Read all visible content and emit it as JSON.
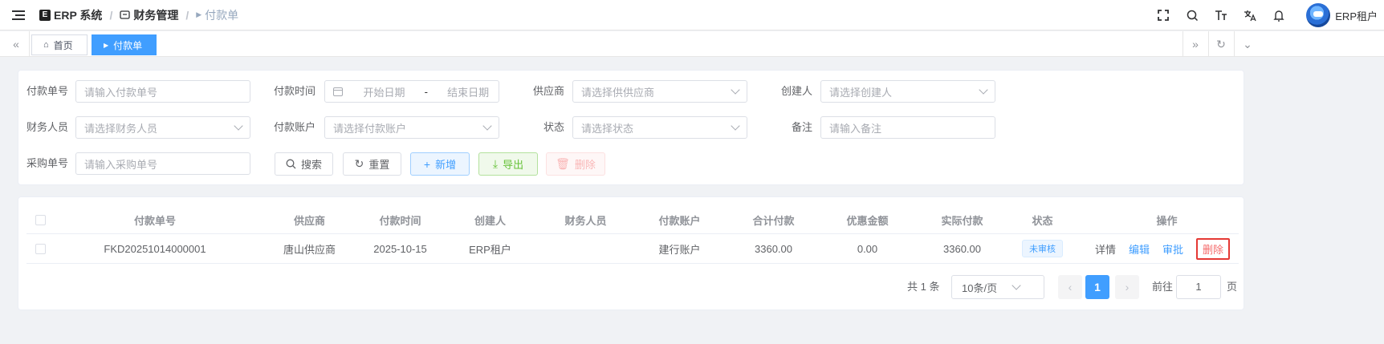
{
  "header": {
    "app_logo_text": "E",
    "breadcrumb": [
      {
        "label": "ERP 系统"
      },
      {
        "label": "财务管理"
      },
      {
        "label": "付款单"
      }
    ],
    "separator": "/",
    "icons": [
      "fullscreen-icon",
      "search-icon",
      "font-size-icon",
      "translate-icon",
      "bell-icon"
    ],
    "user_name": "ERP租户"
  },
  "tags": {
    "home": "首页",
    "current": "付款单"
  },
  "search": {
    "fields": {
      "payment_no": {
        "label": "付款单号",
        "placeholder": "请输入付款单号"
      },
      "payment_time": {
        "label": "付款时间",
        "start_placeholder": "开始日期",
        "separator": "-",
        "end_placeholder": "结束日期"
      },
      "supplier": {
        "label": "供应商",
        "placeholder": "请选择供供应商"
      },
      "creator": {
        "label": "创建人",
        "placeholder": "请选择创建人"
      },
      "finance_user": {
        "label": "财务人员",
        "placeholder": "请选择财务人员"
      },
      "account": {
        "label": "付款账户",
        "placeholder": "请选择付款账户"
      },
      "status": {
        "label": "状态",
        "placeholder": "请选择状态"
      },
      "remark": {
        "label": "备注",
        "placeholder": "请输入备注"
      },
      "purchase_no": {
        "label": "采购单号",
        "placeholder": "请输入采购单号"
      }
    },
    "buttons": {
      "search": "搜索",
      "reset": "重置",
      "add": "新增",
      "export": "导出",
      "delete": "删除"
    }
  },
  "table": {
    "columns": [
      "付款单号",
      "供应商",
      "付款时间",
      "创建人",
      "财务人员",
      "付款账户",
      "合计付款",
      "优惠金额",
      "实际付款",
      "状态",
      "操作"
    ],
    "rows": [
      {
        "no": "FKD20251014000001",
        "supplier": "唐山供应商",
        "time": "2025-10-15",
        "creator": "ERP租户",
        "finance_user": "",
        "account": "建行账户",
        "total": "3360.00",
        "discount": "0.00",
        "actual": "3360.00",
        "status": "未审核",
        "actions": {
          "detail": "详情",
          "edit": "编辑",
          "approve": "审批",
          "delete": "删除"
        }
      }
    ]
  },
  "pagination": {
    "total_text": "共 1 条",
    "page_size": "10条/页",
    "current_page": "1",
    "goto_label": "前往",
    "goto_value": "1",
    "page_suffix": "页"
  }
}
